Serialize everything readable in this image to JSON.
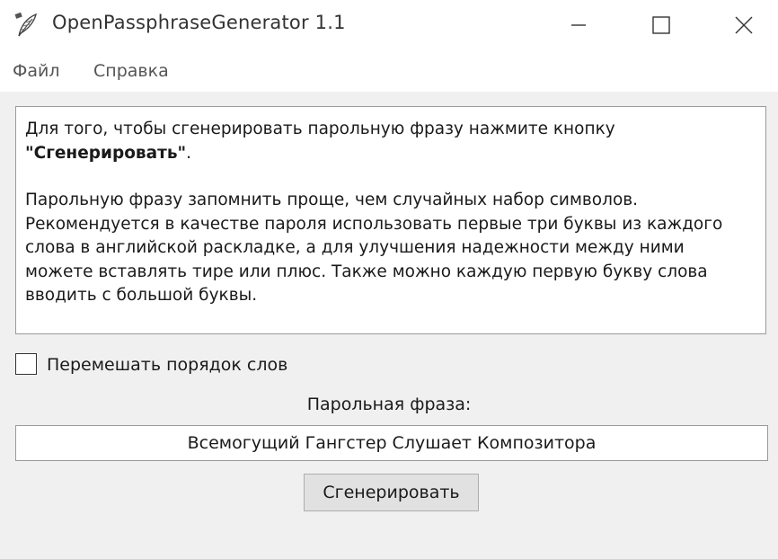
{
  "window": {
    "title": "OpenPassphraseGenerator 1.1",
    "icon": "feather-icon",
    "controls": [
      "minimize-icon",
      "maximize-icon",
      "close-icon"
    ]
  },
  "menu": {
    "items": [
      {
        "label": "Файл"
      },
      {
        "label": "Справка"
      }
    ]
  },
  "info": {
    "line1": "Для того, чтобы сгенерировать парольную фразу нажмите кнопку",
    "button_name": "\"Сгенерировать\"",
    "period": ".",
    "paragraph2": [
      "Парольную фразу запомнить проще, чем случайных набор символов.",
      "Рекомендуется в качестве пароля использовать первые три буквы из каждого",
      "слова в английской раскладке, а для улучшения надежности между ними",
      "можете вставлять тире или плюс. Также можно каждую первую букву слова",
      "вводить с большой буквы."
    ]
  },
  "shuffle": {
    "label": "Перемешать порядок слов",
    "checked": false
  },
  "passphrase": {
    "label": "Парольная фраза:",
    "value": "Всемогущий Гангстер Слушает Композитора"
  },
  "generate_button": {
    "label": "Сгенерировать"
  },
  "colors": {
    "window_bg": "#f0f0f0",
    "field_bg": "#ffffff",
    "button_bg": "#e1e1e1"
  }
}
